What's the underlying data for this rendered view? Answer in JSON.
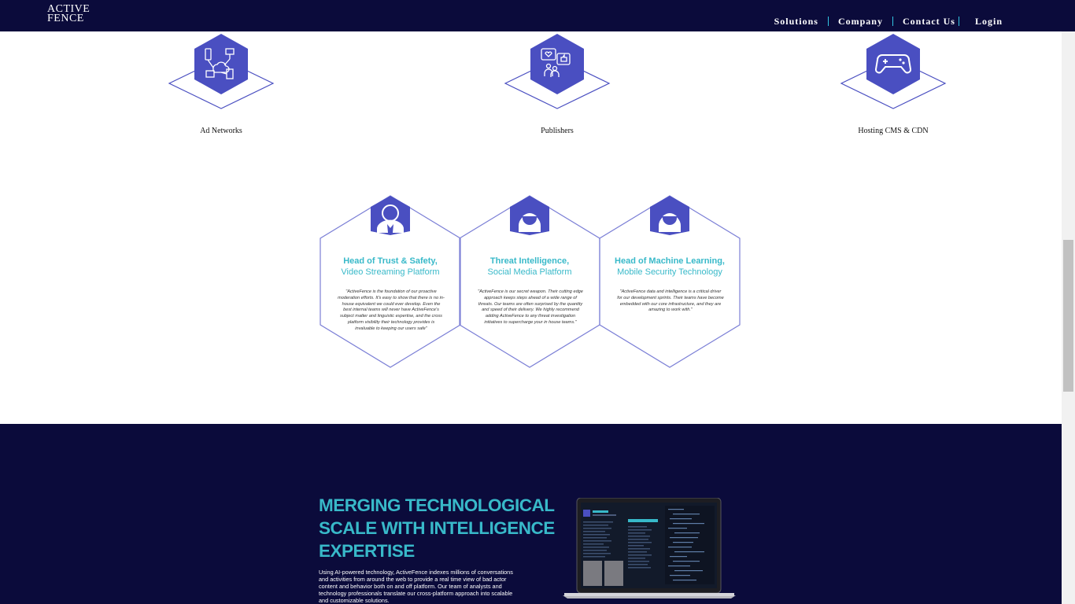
{
  "header": {
    "logo_line1": "ACTIVE",
    "logo_line2": "FENCE",
    "nav": {
      "solutions": "Solutions",
      "company": "Company",
      "contact": "Contact Us",
      "login": "Login"
    }
  },
  "industries": [
    {
      "label": "Ad Networks",
      "icon": "network-devices-icon"
    },
    {
      "label": "Publishers",
      "icon": "social-chat-icon"
    },
    {
      "label": "Hosting CMS & CDN",
      "icon": "gamepad-icon"
    }
  ],
  "testimonials": [
    {
      "title": "Head of Trust & Safety,",
      "subtitle": "Video Streaming Platform",
      "quote": "\"ActiveFence is the foundation of our proactive moderation efforts. It's easy to show that there is no in-house equivalent we could ever develop. Even the best internal teams will never have ActiveFence's subject matter and linguistic expertise, and the cross platform visibility their technology provides is invaluable to keeping our users safe\"",
      "icon": "man-avatar-icon"
    },
    {
      "title": "Threat Intelligence,",
      "subtitle": "Social Media Platform",
      "quote": "\"ActiveFence is our secret weapon. Their cutting edge approach keeps steps ahead of a wide range of threats. Our teams are often surprised by the quantity and speed of their delivery. We highly recommend adding ActiveFence to any threat investigation initiatives to supercharge your in house teams.\"",
      "icon": "woman-avatar-icon"
    },
    {
      "title": "Head of Machine Learning,",
      "subtitle": "Mobile Security Technology",
      "quote": "\"ActiveFence data and intelligence is a critical driver for our development sprints. Their teams have become embedded with our core infrastructure, and they are amazing to work with.\"",
      "icon": "woman-avatar-icon"
    }
  ],
  "merging": {
    "headline_line1": "MERGING TECHNOLOGICAL",
    "headline_line2": "SCALE WITH INTELLIGENCE",
    "headline_line3": "EXPERTISE",
    "body": "Using AI-powered technology, ActiveFence indexes millions of conversations and activities from around the web to provide a real time view of bad actor content and behavior both on and off platform.  Our team of analysts and technology professionals translate our cross-platform approach into scalable and customizable solutions."
  },
  "colors": {
    "navy": "#0b0b3b",
    "accent_teal": "#38b9c9",
    "hex_purple": "#4a4fc1",
    "divider_cyan": "#32c6e3"
  }
}
